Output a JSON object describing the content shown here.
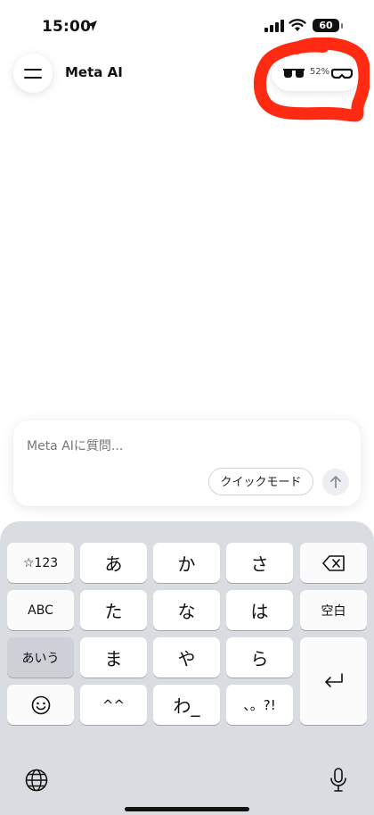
{
  "status_bar": {
    "time": "15:00",
    "battery": "60"
  },
  "header": {
    "title": "Meta AI",
    "glasses_battery": "52%"
  },
  "composer": {
    "placeholder": "Meta AIに質問...",
    "quick_mode_label": "クイックモード"
  },
  "keyboard": {
    "rows": [
      [
        "☆123",
        "あ",
        "か",
        "さ"
      ],
      [
        "ABC",
        "た",
        "な",
        "は",
        "空白"
      ],
      [
        "あいう",
        "ま",
        "や",
        "ら"
      ],
      [
        "^^",
        "わ_",
        "、。?!"
      ]
    ]
  },
  "colors": {
    "highlight": "#ff2a12",
    "keyboard_bg": "#d9dde2"
  }
}
